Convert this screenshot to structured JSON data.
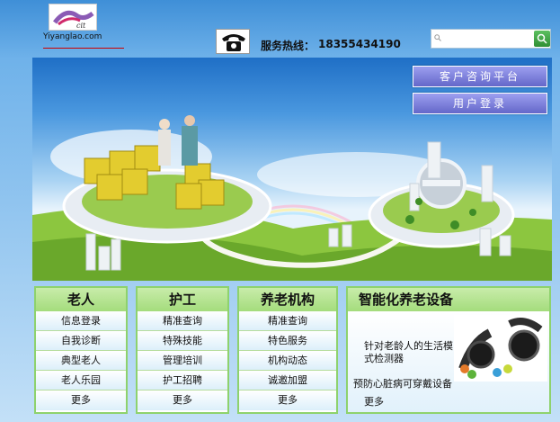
{
  "header": {
    "logo_text": "Yiyanglao.com",
    "hotline_label": "服务热线：",
    "hotline_number": "18355434190",
    "search_placeholder": ""
  },
  "banner": {
    "consult_button": "客户咨询平台",
    "login_button": "用户登录"
  },
  "cards": [
    {
      "title": "老人",
      "items": [
        "信息登录",
        "自我诊断",
        "典型老人",
        "老人乐园",
        "更多"
      ]
    },
    {
      "title": "护工",
      "items": [
        "精准查询",
        "特殊技能",
        "管理培训",
        "护工招聘",
        "更多"
      ]
    },
    {
      "title": "养老机构",
      "items": [
        "精准查询",
        "特色服务",
        "机构动态",
        "诚邀加盟",
        "更多"
      ]
    },
    {
      "title": "智能化养老设备",
      "items": [
        "针对老龄人的生活模式检测器",
        "预防心脏病可穿戴设备",
        "更多"
      ]
    }
  ],
  "colors": {
    "accent_green": "#8ed26d",
    "button_purple": "#6467c9",
    "sky_blue": "#4a98df"
  }
}
